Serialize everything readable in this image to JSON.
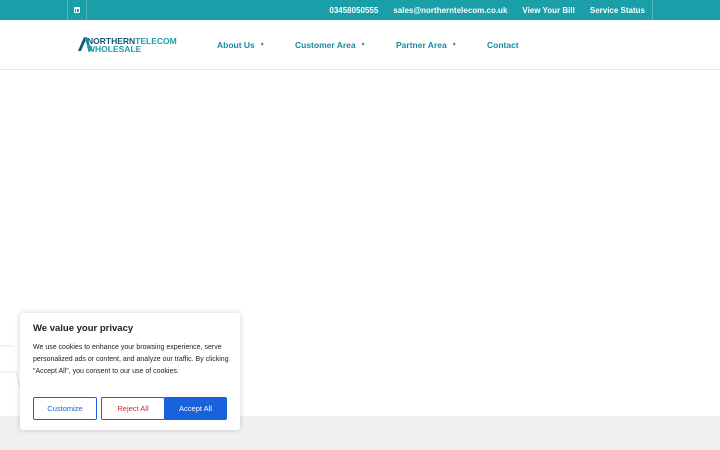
{
  "topbar": {
    "social_icon": "linkedin-icon",
    "links": [
      "03458050555",
      "sales@northerntelecom.co.uk",
      "View Your Bill",
      "Service Status"
    ],
    "background": "#1a9ea7"
  },
  "header": {
    "logo": {
      "line1_a": "NORTHERN",
      "line1_b": "TELECOM",
      "line2": "WHOLESALE"
    },
    "nav": [
      {
        "label": "About Us",
        "has_dropdown": true
      },
      {
        "label": "Customer Area",
        "has_dropdown": true
      },
      {
        "label": "Partner Area",
        "has_dropdown": true
      },
      {
        "label": "Contact",
        "has_dropdown": false
      }
    ],
    "caret": "▼"
  },
  "cookie_banner": {
    "title": "We value your privacy",
    "body": "We use cookies to enhance your browsing experience, serve personalized ads or content, and analyze our traffic. By clicking \"Accept All\", you consent to our use of cookies.",
    "customize_label": "Customize",
    "reject_label": "Reject All",
    "accept_label": "Accept All",
    "accent": "#1863dc",
    "reject_color": "#c92c2c"
  }
}
